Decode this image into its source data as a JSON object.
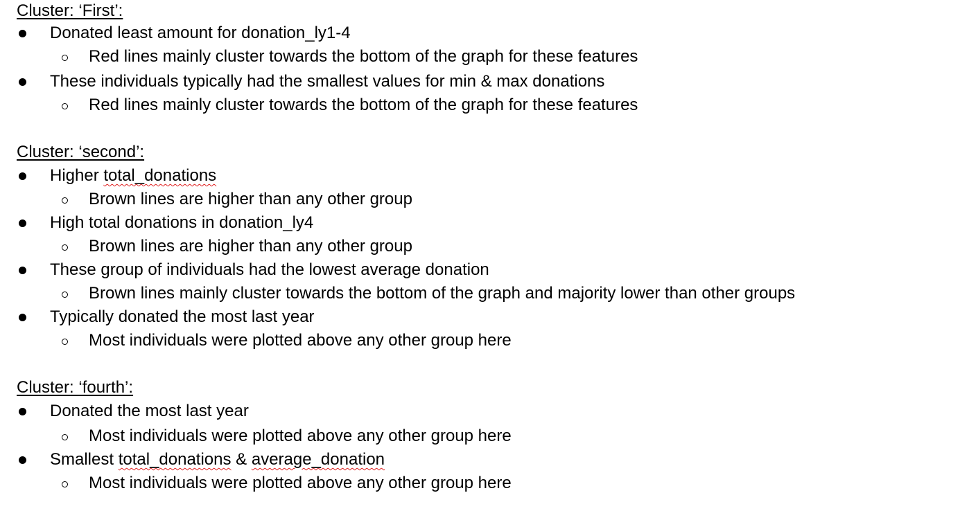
{
  "colors": {
    "text": "#000000",
    "spellcheck_underline": "#e02020"
  },
  "sections": [
    {
      "heading": "Cluster: ‘First’:",
      "items": [
        {
          "text": "Donated least amount for donation_ly1-4",
          "sub": "Red lines mainly cluster towards the bottom of the graph for these features"
        },
        {
          "text": "These individuals typically had the smallest values for min & max donations",
          "sub": "Red lines mainly cluster towards the bottom of the graph for these features"
        }
      ]
    },
    {
      "heading": "Cluster: ‘second’:",
      "items": [
        {
          "text_pre": "Higher ",
          "text_flag": "total_donations",
          "sub": "Brown lines are higher than any other group"
        },
        {
          "text": "High total donations in donation_ly4",
          "sub": "Brown lines are higher than any other group"
        },
        {
          "text": "These group of individuals had the lowest average donation",
          "sub": "Brown lines mainly cluster towards the bottom of the graph and majority lower than other groups"
        },
        {
          "text": "Typically donated the most last year",
          "sub": "Most individuals were plotted above any other group here"
        }
      ]
    },
    {
      "heading": "Cluster: ‘fourth’:",
      "items": [
        {
          "text": "Donated the most last year",
          "sub": "Most individuals were plotted above any other group here"
        },
        {
          "text_pre": "Smallest ",
          "text_flag": "total_donations",
          "text_mid": " & ",
          "text_flag2": "average_donation",
          "sub": "Most individuals were plotted above any other group here"
        }
      ]
    }
  ]
}
